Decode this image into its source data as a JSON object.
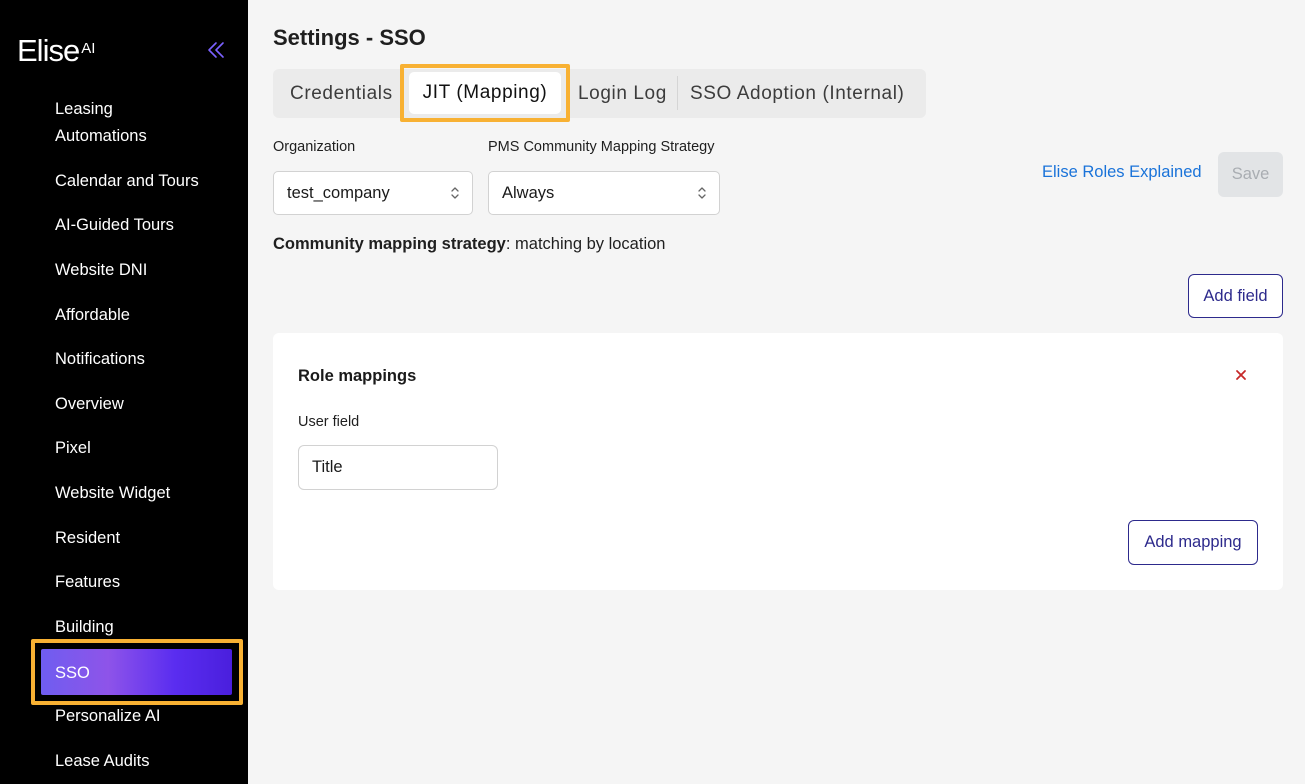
{
  "app": {
    "logo_main": "Elise",
    "logo_sup": "AI"
  },
  "sidebar": {
    "items": [
      {
        "label": "Leasing"
      },
      {
        "label": "Automations"
      },
      {
        "label": "Calendar and Tours"
      },
      {
        "label": "AI-Guided Tours"
      },
      {
        "label": "Website DNI"
      },
      {
        "label": "Affordable"
      },
      {
        "label": "Notifications"
      },
      {
        "label": "Overview"
      },
      {
        "label": "Pixel"
      },
      {
        "label": "Website Widget"
      },
      {
        "label": "Resident"
      },
      {
        "label": "Features"
      },
      {
        "label": "Building"
      },
      {
        "label": "SSO"
      },
      {
        "label": "Personalize AI"
      },
      {
        "label": "Lease Audits"
      }
    ],
    "active_item": "SSO"
  },
  "page": {
    "title": "Settings - SSO"
  },
  "tabs": [
    {
      "label": "Credentials"
    },
    {
      "label": "JIT (Mapping)"
    },
    {
      "label": "Login Log"
    },
    {
      "label": "SSO Adoption (Internal)"
    }
  ],
  "active_tab": "JIT (Mapping)",
  "form": {
    "organization_label": "Organization",
    "organization_value": "test_company",
    "strategy_label": "PMS Community Mapping Strategy",
    "strategy_value": "Always",
    "roles_link": "Elise Roles Explained",
    "save_label": "Save",
    "strategy_summary_label": "Community mapping strategy",
    "strategy_summary_value": ": matching by location",
    "add_field_label": "Add field"
  },
  "card": {
    "title": "Role mappings",
    "user_field_label": "User field",
    "user_field_value": "Title",
    "add_mapping_label": "Add mapping"
  },
  "colors": {
    "highlight": "#f8b133",
    "link": "#1a73d9",
    "button_text": "#2d2a8c",
    "close": "#c62828"
  }
}
